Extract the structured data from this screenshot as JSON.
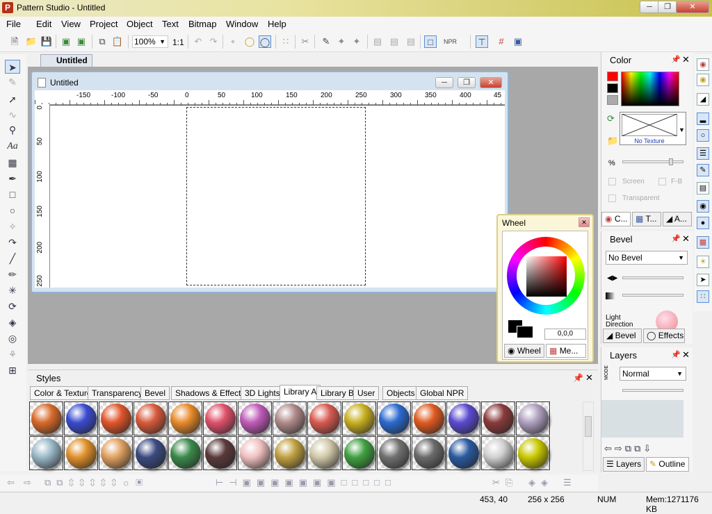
{
  "window": {
    "title": "Pattern Studio - Untitled",
    "app_icon": "P"
  },
  "menu": [
    "File",
    "Edit",
    "View",
    "Project",
    "Object",
    "Text",
    "Bitmap",
    "Window",
    "Help"
  ],
  "toolbar": {
    "zoom": "100%",
    "ratio": "1:1"
  },
  "document": {
    "tab": "Untitled",
    "title": "Untitled"
  },
  "ruler": {
    "h_ticks": [
      "-150",
      "-100",
      "-50",
      "0",
      "50",
      "100",
      "150",
      "200",
      "250",
      "300",
      "350",
      "400",
      "45"
    ],
    "v_ticks": [
      "0",
      "50",
      "100",
      "150",
      "200",
      "250"
    ]
  },
  "styles": {
    "title": "Styles",
    "tabs": [
      "Color & Texture",
      "Transparency",
      "Bevel",
      "Shadows & Effects",
      "3D Lights",
      "Library A",
      "Library B",
      "User",
      "Objects",
      "Global NPR"
    ],
    "active_tab": "Library A",
    "row1_colors": [
      "#d86a2a",
      "#3a4bcf",
      "#e0552a",
      "#d85a3a",
      "#e88a2a",
      "#e0506a",
      "#c05ab8",
      "#b08a8a",
      "#d85a50",
      "#c8b020",
      "#2a6ad0",
      "#e05a20",
      "#5a4ad0",
      "#8a3a3a",
      "#b0a0c0"
    ],
    "row2_colors": [
      "#9ab8c8",
      "#e0902a",
      "#e0a060",
      "#3a4a80",
      "#3a8a4a",
      "#5a3a3a",
      "#f0c0c0",
      "#c0a040",
      "#d0c8a8",
      "#40a040",
      "#707070",
      "#6a6a6a",
      "#2a5aa0",
      "#d0d0d0",
      "#c8c800"
    ]
  },
  "color_panel": {
    "title": "Color",
    "texture_label": "No Texture",
    "percent_label": "%",
    "screen_label": "Screen",
    "fb_label": "F-B",
    "transparent_label": "Transparent",
    "tabs": [
      "C...",
      "T...",
      "A..."
    ],
    "primary_color": "#ff0000",
    "secondary_color": "#000000"
  },
  "bevel_panel": {
    "title": "Bevel",
    "select_value": "No Bevel",
    "light_label": "Light",
    "direction_label": "Direction",
    "tabs": [
      "Bevel",
      "Effects"
    ]
  },
  "layers_panel": {
    "title": "Layers",
    "mode_label": "MODE",
    "blend_value": "Normal",
    "tabs": [
      "Layers",
      "Outline"
    ]
  },
  "wheel": {
    "title": "Wheel",
    "value": "0,0,0",
    "tabs": [
      "Wheel",
      "Me..."
    ]
  },
  "status": {
    "coords": "453, 40",
    "size": "256 x 256",
    "num": "NUM",
    "mem": "Mem:1271176 KB"
  }
}
